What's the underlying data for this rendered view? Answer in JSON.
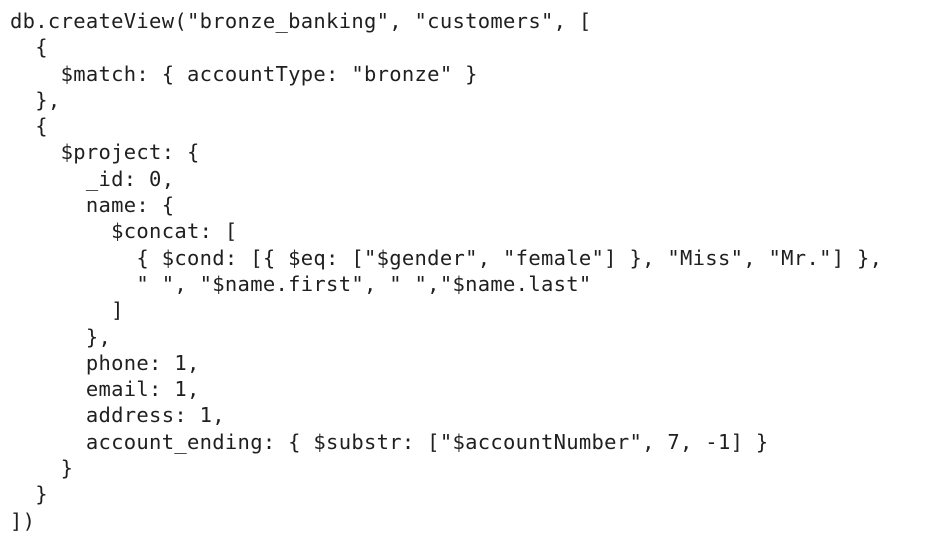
{
  "code": {
    "lines": [
      "db.createView(\"bronze_banking\", \"customers\", [",
      "  {",
      "    $match: { accountType: \"bronze\" }",
      "  },",
      "  {",
      "    $project: {",
      "      _id: 0,",
      "      name: {",
      "        $concat: [",
      "          { $cond: [{ $eq: [\"$gender\", \"female\"] }, \"Miss\", \"Mr.\"] },",
      "          \" \", \"$name.first\", \" \",\"$name.last\"",
      "        ]",
      "      },",
      "      phone: 1,",
      "      email: 1,",
      "      address: 1,",
      "      account_ending: { $substr: [\"$accountNumber\", 7, -1] }",
      "    }",
      "  }",
      "])"
    ]
  }
}
